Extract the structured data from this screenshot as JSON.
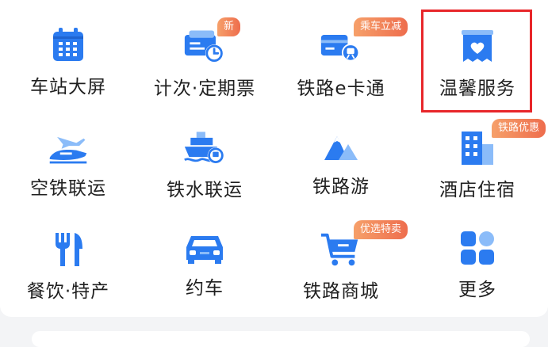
{
  "colors": {
    "icon_blue": "#2b7bf0",
    "icon_light_blue": "#8bbcf9",
    "badge_start": "#f6a06a",
    "badge_end": "#ee6d4d",
    "highlight_red": "#e8262a"
  },
  "grid": {
    "items": [
      {
        "label": "车站大屏",
        "icon": "calendar-screen-icon"
      },
      {
        "label": "计次·定期票",
        "icon": "ticket-clock-icon",
        "badge": "新"
      },
      {
        "label": "铁路e卡通",
        "icon": "railcard-icon",
        "badge": "乘车立减"
      },
      {
        "label": "温馨服务",
        "icon": "heart-service-icon"
      },
      {
        "label": "空铁联运",
        "icon": "plane-train-icon"
      },
      {
        "label": "铁水联运",
        "icon": "ship-rail-icon"
      },
      {
        "label": "铁路游",
        "icon": "mountain-travel-icon"
      },
      {
        "label": "酒店住宿",
        "icon": "hotel-building-icon",
        "badge": "铁路优惠"
      },
      {
        "label": "餐饮·特产",
        "icon": "fork-knife-icon"
      },
      {
        "label": "约车",
        "icon": "car-icon"
      },
      {
        "label": "铁路商城",
        "icon": "shopping-cart-icon",
        "badge": "优选特卖"
      },
      {
        "label": "更多",
        "icon": "more-grid-icon"
      }
    ]
  }
}
